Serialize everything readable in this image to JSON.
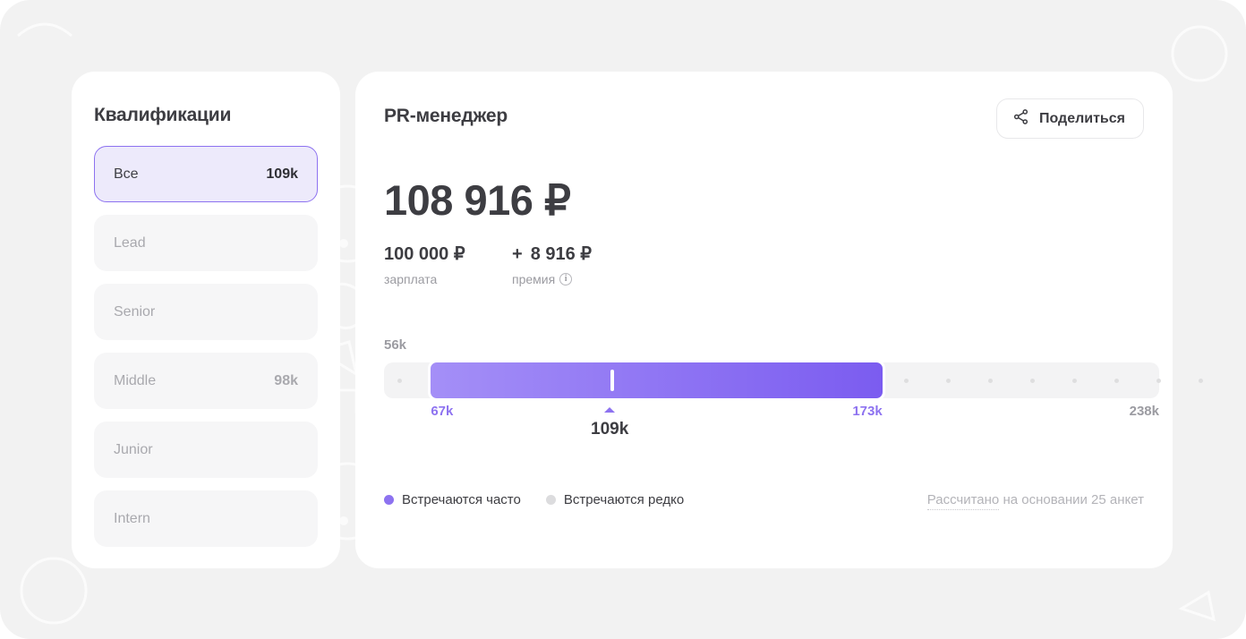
{
  "theme": {
    "page_bg": "#f2f2f2",
    "card_bg": "#ffffff",
    "accent": "#8d72f0",
    "accent_light": "#a48ff7",
    "accent_dark": "#7b5cf0",
    "selected_bg": "#edeafb",
    "muted_text": "#9b9ba1",
    "dark_text": "#3d3d42",
    "track_bg": "#f3f3f4"
  },
  "sidebar": {
    "title": "Квалификации",
    "items": [
      {
        "label": "Все",
        "value": "109k",
        "selected": true
      },
      {
        "label": "Lead",
        "value": "",
        "selected": false
      },
      {
        "label": "Senior",
        "value": "",
        "selected": false
      },
      {
        "label": "Middle",
        "value": "98k",
        "selected": false
      },
      {
        "label": "Junior",
        "value": "",
        "selected": false
      },
      {
        "label": "Intern",
        "value": "",
        "selected": false
      }
    ]
  },
  "main": {
    "job_title": "PR-менеджер",
    "share_button": {
      "label": "Поделиться",
      "icon": "share-nodes-icon"
    },
    "salary": {
      "total": "108 916 ₽",
      "base_value": "100 000 ₽",
      "plus_sign": "+",
      "bonus_value": "8 916 ₽",
      "base_label": "зарплата",
      "bonus_label": "премия",
      "bonus_info_icon": "info-icon",
      "bonus_info_glyph": "i"
    },
    "legend": [
      {
        "label": "Встречаются часто",
        "color": "#8d72f0"
      },
      {
        "label": "Встречаются редко",
        "color": "#dcdcde"
      }
    ],
    "source_note": {
      "link_text": "Рассчитано",
      "rest_text": " на основании 25 анкет"
    }
  },
  "chart_data": {
    "type": "bar",
    "title": "PR-менеджер salary range",
    "xlabel": "",
    "ylabel": "",
    "orientation": "horizontal",
    "axis_min": 56000,
    "axis_max": 238000,
    "axis_min_label": "56k",
    "axis_max_label": "238k",
    "range_low": 67000,
    "range_high": 173000,
    "range_low_label": "67k",
    "range_high_label": "173k",
    "median": 109000,
    "median_label": "109k",
    "grid": false,
    "legend_position": "bottom-left",
    "frequent_range_fill": [
      "#a48ff7",
      "#7b5cf0"
    ],
    "rare_range_fill": "#f3f3f4",
    "track_dot_count_left": 1,
    "track_dot_count_right": 8,
    "series": [
      {
        "name": "Встречаются часто",
        "from": 67000,
        "to": 173000,
        "color": "#8d72f0"
      },
      {
        "name": "Встречаются редко",
        "from": 56000,
        "to": 238000,
        "color": "#dcdcde"
      }
    ],
    "annotations": [
      {
        "label": "109k",
        "value": 109000,
        "type": "median-marker"
      }
    ]
  }
}
